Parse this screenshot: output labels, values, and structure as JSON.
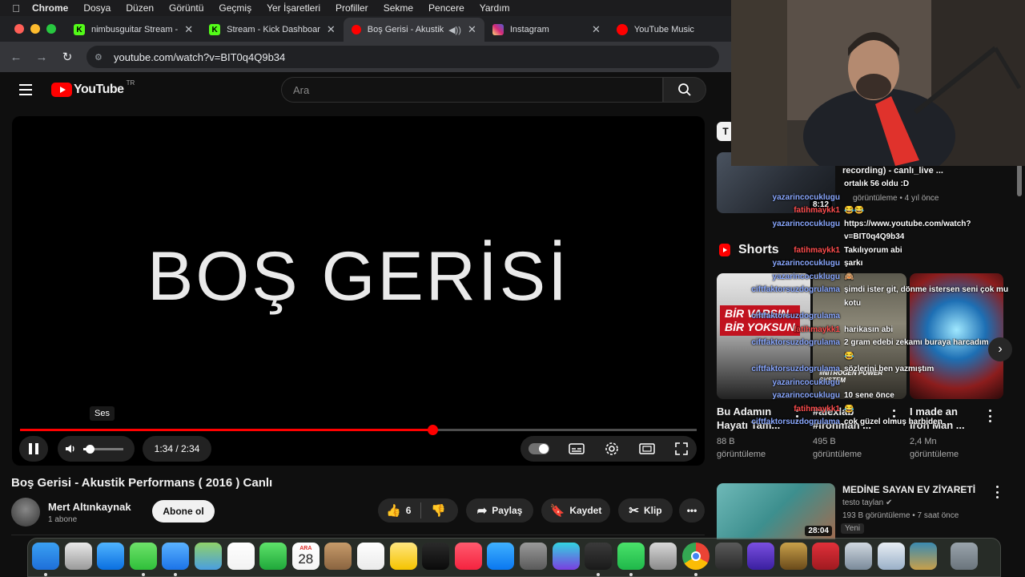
{
  "menubar": {
    "app": "Chrome",
    "items": [
      "Dosya",
      "Düzen",
      "Görüntü",
      "Geçmiş",
      "Yer İşaretleri",
      "Profiller",
      "Sekme",
      "Pencere",
      "Yardım"
    ]
  },
  "browser": {
    "tabs": [
      {
        "title": "nimbusguitar Stream - ",
        "icon": "kick-icon",
        "color": "#53fc18"
      },
      {
        "title": "Stream - Kick Dashboar",
        "icon": "kick-icon",
        "color": "#53fc18"
      },
      {
        "title": "Boş Gerisi - Akustik",
        "icon": "youtube-icon",
        "color": "#ff0000",
        "active": true
      },
      {
        "title": "Instagram",
        "icon": "instagram-icon",
        "color": "#e1306c"
      },
      {
        "title": "YouTube Music",
        "icon": "youtube-music-icon",
        "color": "#ff0000"
      }
    ],
    "url": "youtube.com/watch?v=BIT0q4Q9b34"
  },
  "youtube": {
    "logo_text": "YouTube",
    "region": "TR",
    "search_placeholder": "Ara"
  },
  "player": {
    "video_text": "BOŞ GERİSİ",
    "tooltip": "Ses",
    "time": "1:34 / 2:34",
    "progress": 0.61,
    "volume": 0.15,
    "autoplay": true
  },
  "video": {
    "title": "Boş Gerisi - Akustik Performans ( 2016 ) Canlı",
    "channel": "Mert Altınkaynak",
    "subscribers": "1 abone",
    "subscribe_label": "Abone ol",
    "likes": "6",
    "share_label": "Paylaş",
    "save_label": "Kaydet",
    "clip_label": "Klip"
  },
  "sidebar": {
    "chip": "T",
    "top_video": {
      "title": "recording) - canlı_live ...",
      "views": "görüntüleme • 4 yıl önce",
      "duration": "8:12"
    },
    "shorts_heading": "Shorts",
    "shorts": [
      {
        "title_line1": "Bu Adamın",
        "title_line2": "Hayatı Tam...",
        "views_line1": "88 B",
        "views_line2": "görüntüleme",
        "banner_line1": "BİR VARSIN",
        "banner_line2": "BİR YOKSUN"
      },
      {
        "title_line1": "#alexlab",
        "title_line2": "#ironman ...",
        "views_line1": "495 B",
        "views_line2": "görüntüleme",
        "caption": "#NİTROGEN POWER SYSTEM"
      },
      {
        "title_line1": "I made an",
        "title_line2": "Iron Man ...",
        "views_line1": "2,4 Mn",
        "views_line2": "görüntüleme"
      }
    ],
    "bottom_video": {
      "title": "MEDİNE SAYAN EV ZİYARETİ",
      "channel": "testo taylan",
      "meta": "193 B görüntüleme • 7 saat önce",
      "badge": "Yeni",
      "duration": "28:04"
    }
  },
  "chat": [
    {
      "user": "",
      "text": "ortalık 56 oldu :D",
      "user_color": "#8aa8ff"
    },
    {
      "user": "yazarincocuklugu",
      "text": "",
      "user_color": "#8aa8ff"
    },
    {
      "user": "fatihmaykk1",
      "text": "😂😂",
      "user_color": "#ff4d4d"
    },
    {
      "user": "yazarincocuklugu",
      "text": "https://www.youtube.com/watch?",
      "user_color": "#8aa8ff"
    },
    {
      "user": "",
      "text": "v=BIT0q4Q9b34",
      "user_color": "#8aa8ff"
    },
    {
      "user": "fatihmaykk1",
      "text": "Takılıyorum abi",
      "user_color": "#ff4d4d"
    },
    {
      "user": "yazarincocuklugu",
      "text": "şarkı",
      "user_color": "#8aa8ff"
    },
    {
      "user": "yazarincocuklugu",
      "text": "🙈",
      "user_color": "#8aa8ff"
    },
    {
      "user": "ciftfaktorsuzdogrulama",
      "text": "şimdi ister git, dönme istersen seni çok mu",
      "user_color": "#8aa8ff"
    },
    {
      "user": "",
      "text": "kotu",
      "user_color": "#8aa8ff"
    },
    {
      "user": "ciftfaktorsuzdogrulama",
      "text": "",
      "user_color": "#8aa8ff"
    },
    {
      "user": "fatihmaykk1",
      "text": "harikasın abi",
      "user_color": "#ff4d4d"
    },
    {
      "user": "ciftfaktorsuzdogrulama",
      "text": "2 gram edebi zekamı buraya harcadım",
      "user_color": "#8aa8ff"
    },
    {
      "user": "",
      "text": "😂",
      "user_color": "#8aa8ff"
    },
    {
      "user": "ciftfaktorsuzdogrulama",
      "text": "sözlerini ben yazmıştım",
      "user_color": "#8aa8ff"
    },
    {
      "user": "yazarincocuklugu",
      "text": "",
      "user_color": "#8aa8ff"
    },
    {
      "user": "yazarincocuklugu",
      "text": "10 sene önce",
      "user_color": "#8aa8ff"
    },
    {
      "user": "fatihmaykk1",
      "text": "😂",
      "user_color": "#ff4d4d"
    },
    {
      "user": "ciftfaktorsuzdogrulama",
      "text": "çok güzel olmuş harbiden",
      "user_color": "#8aa8ff"
    }
  ],
  "dock": {
    "calendar_month": "ARA",
    "calendar_day": "28",
    "apps": [
      "finder",
      "launchpad",
      "safari",
      "messages",
      "mail",
      "maps",
      "photos",
      "facetime",
      "calendar",
      "contacts",
      "reminders",
      "notes",
      "tv",
      "music",
      "app-store",
      "system-settings",
      "canva",
      "obs",
      "whatsapp",
      "disk-utility",
      "chrome",
      "calculator",
      "imovie",
      "league-of-legends",
      "kick",
      "screenshot",
      "preview",
      "league-client",
      "trash"
    ]
  }
}
